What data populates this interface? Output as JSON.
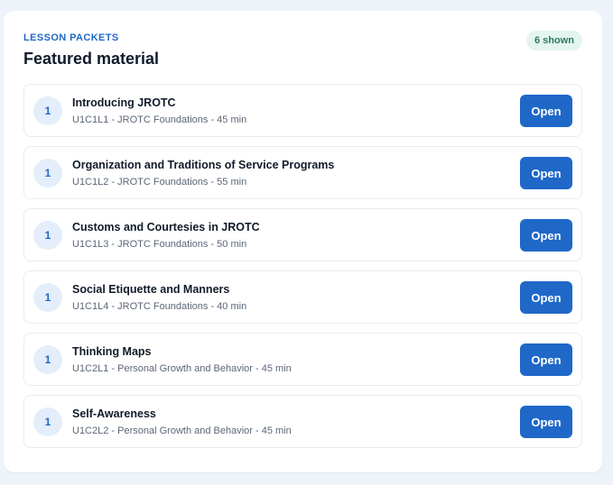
{
  "header": {
    "eyebrow": "LESSON PACKETS",
    "title": "Featured material",
    "count_badge": "6 shown"
  },
  "lessons": [
    {
      "number": "1",
      "title": "Introducing JROTC",
      "meta": "U1C1L1 - JROTC Foundations - 45 min",
      "action": "Open"
    },
    {
      "number": "1",
      "title": "Organization and Traditions of Service Programs",
      "meta": "U1C1L2 - JROTC Foundations - 55 min",
      "action": "Open"
    },
    {
      "number": "1",
      "title": "Customs and Courtesies in JROTC",
      "meta": "U1C1L3 - JROTC Foundations - 50 min",
      "action": "Open"
    },
    {
      "number": "1",
      "title": "Social Etiquette and Manners",
      "meta": "U1C1L4 - JROTC Foundations - 40 min",
      "action": "Open"
    },
    {
      "number": "1",
      "title": "Thinking Maps",
      "meta": "U1C2L1 - Personal Growth and Behavior - 45 min",
      "action": "Open"
    },
    {
      "number": "1",
      "title": "Self-Awareness",
      "meta": "U1C2L2 - Personal Growth and Behavior - 45 min",
      "action": "Open"
    }
  ],
  "colors": {
    "accent": "#1f68c8",
    "badge_bg": "#e3f5ee",
    "badge_text": "#2b7a5f"
  }
}
